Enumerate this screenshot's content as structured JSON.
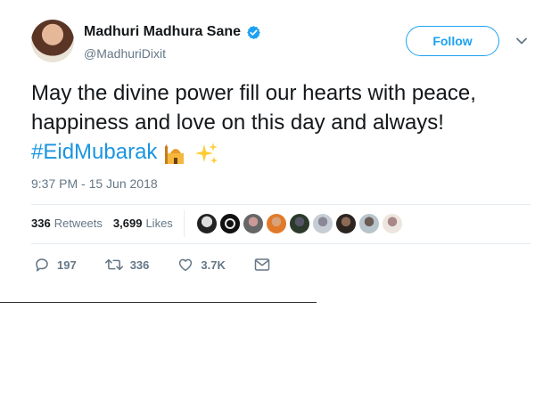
{
  "author": {
    "display_name": "Madhuri Madhura Sane",
    "handle": "@MadhuriDixit",
    "verified": true
  },
  "follow_label": "Follow",
  "tweet": {
    "text_main": "May the divine power fill our hearts with peace, happiness and love on this day and always! ",
    "hashtag": "#EidMubarak",
    "timestamp": "9:37 PM - 15 Jun 2018"
  },
  "stats": {
    "retweets_count": "336",
    "retweets_label": "Retweets",
    "likes_count": "3,699",
    "likes_label": "Likes"
  },
  "actions": {
    "reply_count": "197",
    "retweet_count": "336",
    "like_count": "3.7K"
  },
  "icons": [
    "verified-icon",
    "chevron-down-icon",
    "mosque-icon",
    "sparkles-icon",
    "reply-icon",
    "retweet-icon",
    "heart-icon",
    "message-icon"
  ],
  "colors": {
    "accent": "#1da1f2",
    "hashtag": "#1b95e0",
    "muted": "#657786",
    "text": "#14171a"
  }
}
